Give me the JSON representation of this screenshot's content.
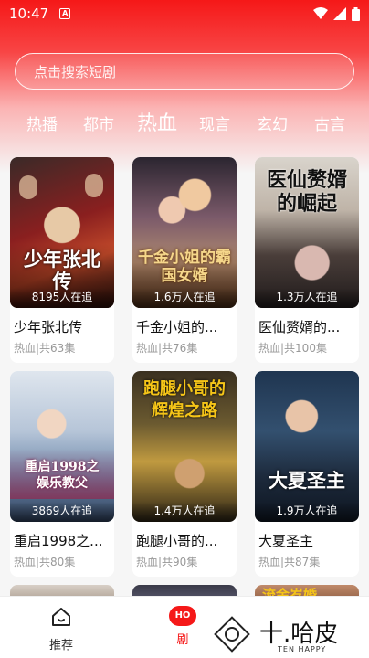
{
  "status": {
    "time": "10:47",
    "a_badge": "A"
  },
  "search": {
    "placeholder": "点击搜索短剧"
  },
  "tabs": [
    {
      "label": "热播"
    },
    {
      "label": "都市"
    },
    {
      "label": "热血",
      "active": true
    },
    {
      "label": "现言"
    },
    {
      "label": "玄幻"
    },
    {
      "label": "古言"
    }
  ],
  "dramas": [
    {
      "title": "少年张北传",
      "meta": "热血|共63集",
      "count": "8195人在追",
      "poster_text": "少年张北传"
    },
    {
      "title": "千金小姐的...",
      "meta": "热血|共76集",
      "count": "1.6万人在追",
      "poster_text": "千金小姐的霸国女婿"
    },
    {
      "title": "医仙赘婿的...",
      "meta": "热血|共100集",
      "count": "1.3万人在追",
      "poster_text": "医仙赘婿的崛起"
    },
    {
      "title": "重启1998之...",
      "meta": "热血|共80集",
      "count": "3869人在追",
      "poster_text": "重启1998之娱乐教父"
    },
    {
      "title": "跑腿小哥的...",
      "meta": "热血|共90集",
      "count": "1.4万人在追",
      "poster_text": "跑腿小哥的辉煌之路"
    },
    {
      "title": "大夏圣主",
      "meta": "热血|共87集",
      "count": "1.9万人在追",
      "poster_text": "大夏圣主"
    }
  ],
  "peek_text": "流金岁婚",
  "nav": {
    "home_label": "推荐",
    "drama_label": "剧",
    "hot_badge": "HO"
  },
  "watermark": {
    "text": "十.哈皮",
    "sub": "TEN HAPPY"
  },
  "colors": {
    "brand_red": "#f51818",
    "accent_gold": "#f5c518"
  }
}
